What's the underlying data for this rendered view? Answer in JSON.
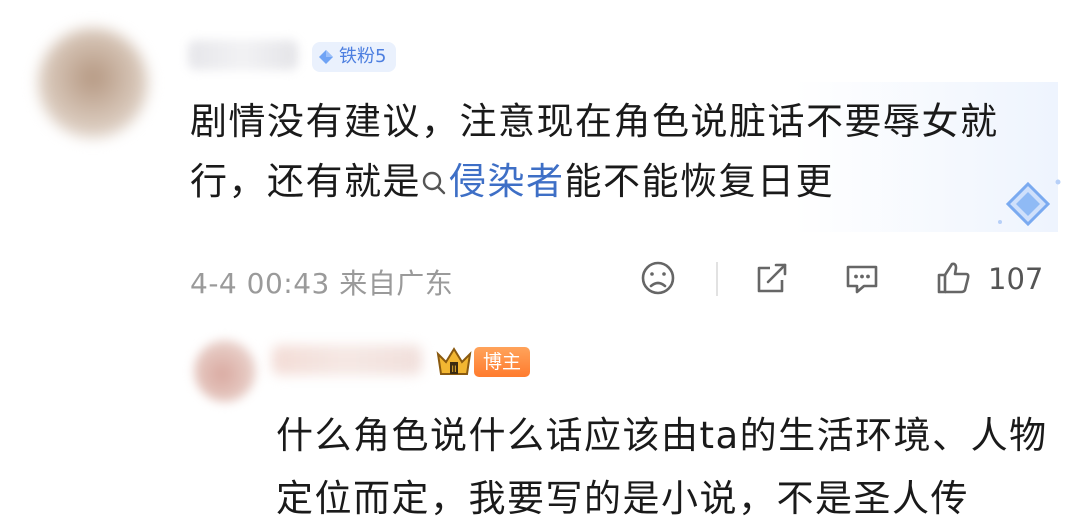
{
  "comment": {
    "badge_label": "铁粉5",
    "text_part1": "剧情没有建议，注意现在角色说脏话不要辱女就行，还有就是",
    "search_term": "侵染者",
    "text_part2": "能不能恢复日更",
    "timestamp": "4-4 00:43",
    "location": "来自广东",
    "like_count": "107"
  },
  "reply": {
    "badge_label": "博主",
    "text": "什么角色说什么话应该由ta的生活环境、人物定位而定，我要写的是小说，不是圣人传"
  },
  "icons": {
    "fan_badge": "diamond-icon",
    "search": "search-icon",
    "dislike": "sad-face-icon",
    "share": "share-icon",
    "reply": "comment-icon",
    "like": "thumbs-up-icon",
    "crown": "crown-icon"
  },
  "colors": {
    "link_blue": "#3e6fc6",
    "fan_badge_text": "#4d7fe0",
    "host_badge_bg": "#ff7b2e",
    "meta_gray": "#9a9a9a"
  }
}
